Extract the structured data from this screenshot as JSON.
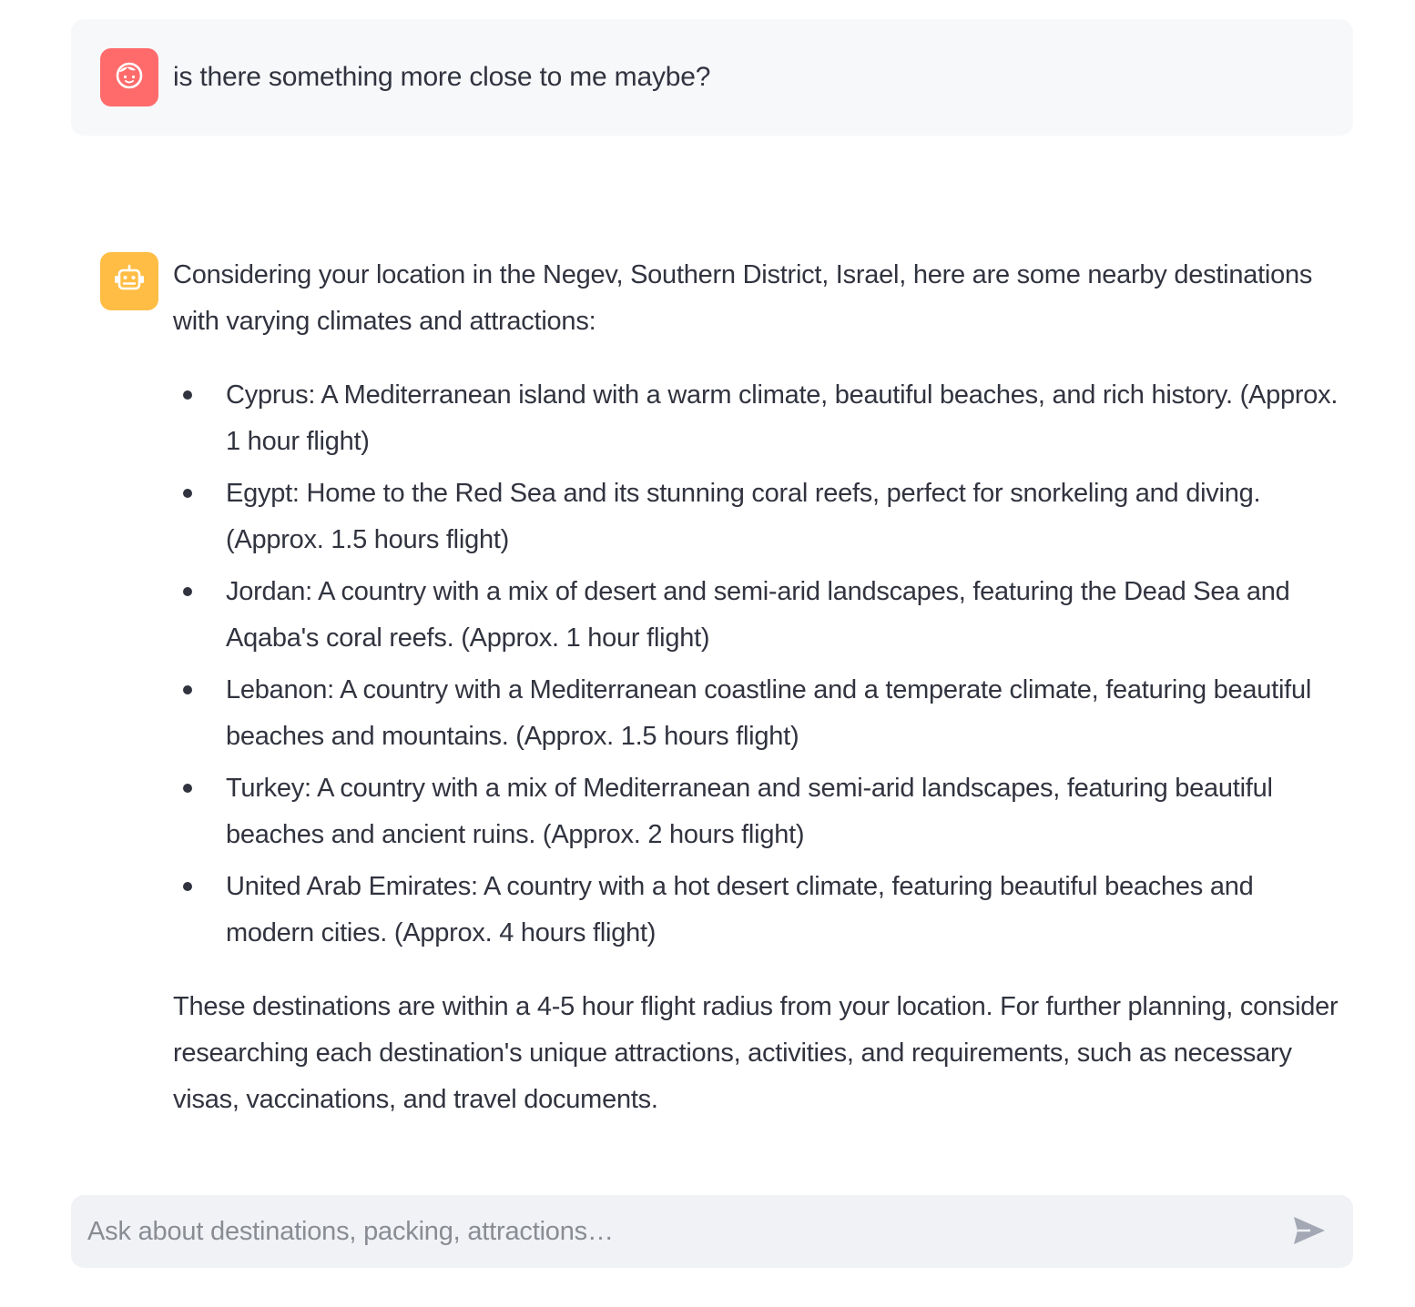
{
  "user_message": {
    "avatar_icon": "user-face-icon",
    "avatar_color": "#ff6b6b",
    "text": "is there something more close to me maybe?"
  },
  "assistant_message": {
    "avatar_icon": "robot-icon",
    "avatar_color": "#ffbd45",
    "intro": "Considering your location in the Negev, Southern District, Israel, here are some nearby destinations with varying climates and attractions:",
    "destinations": [
      "Cyprus: A Mediterranean island with a warm climate, beautiful beaches, and rich history. (Approx. 1 hour flight)",
      "Egypt: Home to the Red Sea and its stunning coral reefs, perfect for snorkeling and diving. (Approx. 1.5 hours flight)",
      "Jordan: A country with a mix of desert and semi-arid landscapes, featuring the Dead Sea and Aqaba's coral reefs. (Approx. 1 hour flight)",
      "Lebanon: A country with a Mediterranean coastline and a temperate climate, featuring beautiful beaches and mountains. (Approx. 1.5 hours flight)",
      "Turkey: A country with a mix of Mediterranean and semi-arid landscapes, featuring beautiful beaches and ancient ruins. (Approx. 2 hours flight)",
      "United Arab Emirates: A country with a hot desert climate, featuring beautiful beaches and modern cities. (Approx. 4 hours flight)"
    ],
    "outro": "These destinations are within a 4-5 hour flight radius from your location. For further planning, consider researching each destination's unique attractions, activities, and requirements, such as necessary visas, vaccinations, and travel documents."
  },
  "chat_input": {
    "value": "",
    "placeholder": "Ask about destinations, packing, attractions…",
    "send_icon": "send-icon"
  }
}
